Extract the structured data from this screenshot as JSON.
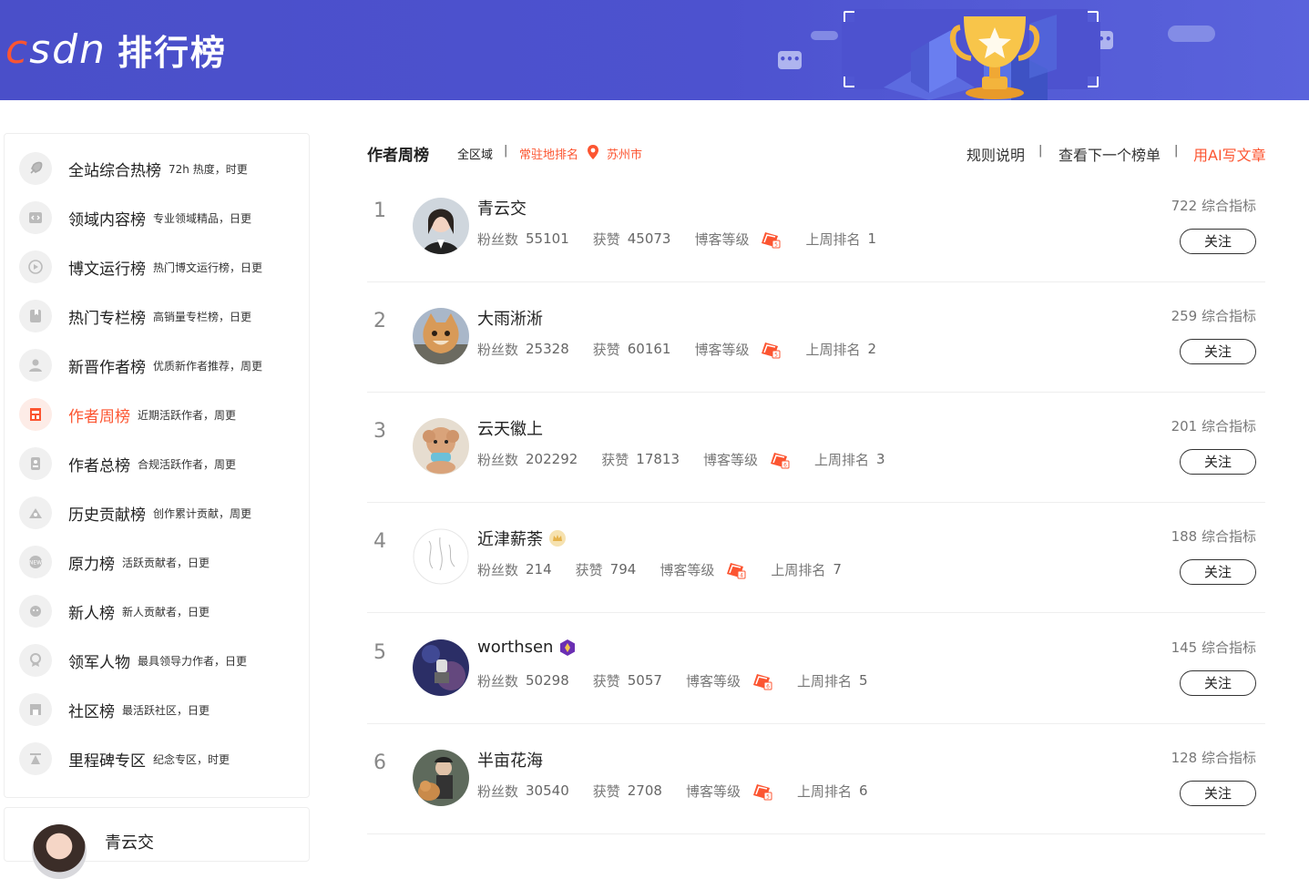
{
  "header": {
    "logo_text": "CSDN",
    "title": "排行榜"
  },
  "sidebar": {
    "items": [
      {
        "name": "全站综合热榜",
        "desc": "72h 热度，时更",
        "icon": "rocket-icon"
      },
      {
        "name": "领域内容榜",
        "desc": "专业领域精品，日更",
        "icon": "code-icon"
      },
      {
        "name": "博文运行榜",
        "desc": "热门博文运行榜，日更",
        "icon": "play-icon"
      },
      {
        "name": "热门专栏榜",
        "desc": "高销量专栏榜，日更",
        "icon": "book-icon"
      },
      {
        "name": "新晋作者榜",
        "desc": "优质新作者推荐，周更",
        "icon": "user-icon"
      },
      {
        "name": "作者周榜",
        "desc": "近期活跃作者，周更",
        "icon": "calendar-icon",
        "active": true
      },
      {
        "name": "作者总榜",
        "desc": "合规活跃作者，周更",
        "icon": "users-icon"
      },
      {
        "name": "历史贡献榜",
        "desc": "创作累计贡献，周更",
        "icon": "contribution-icon"
      },
      {
        "name": "原力榜",
        "desc": "活跃贡献者，日更",
        "icon": "force-icon"
      },
      {
        "name": "新人榜",
        "desc": "新人贡献者，日更",
        "icon": "newbie-icon"
      },
      {
        "name": "领军人物",
        "desc": "最具领导力作者，日更",
        "icon": "medal-icon"
      },
      {
        "name": "社区榜",
        "desc": "最活跃社区，日更",
        "icon": "community-icon"
      },
      {
        "name": "里程碑专区",
        "desc": "纪念专区，时更",
        "icon": "milestone-icon"
      }
    ]
  },
  "profile": {
    "name": "青云交"
  },
  "main": {
    "title": "作者周榜",
    "filter_all": "全区域",
    "filter_resident": "常驻地排名",
    "filter_city": "苏州市",
    "links": {
      "rules": "规则说明",
      "next": "查看下一个榜单",
      "ai": "用AI写文章"
    }
  },
  "labels": {
    "fans": "粉丝数",
    "likes": "获赞",
    "level": "博客等级",
    "last_rank": "上周排名",
    "score_suffix": "综合指标",
    "follow": "关注"
  },
  "rows": [
    {
      "rank": "1",
      "name": "青云交",
      "fans": "55101",
      "likes": "45073",
      "last_rank": "1",
      "score": "722",
      "badge": "",
      "level": "5"
    },
    {
      "rank": "2",
      "name": "大雨淅淅",
      "fans": "25328",
      "likes": "60161",
      "last_rank": "2",
      "score": "259",
      "badge": "",
      "level": "5"
    },
    {
      "rank": "3",
      "name": "云天徽上",
      "fans": "202292",
      "likes": "17813",
      "last_rank": "3",
      "score": "201",
      "badge": "",
      "level": "6"
    },
    {
      "rank": "4",
      "name": "近津薪荼",
      "fans": "214",
      "likes": "794",
      "last_rank": "7",
      "score": "188",
      "badge": "crown-badge-icon",
      "level": "4"
    },
    {
      "rank": "5",
      "name": "worthsen",
      "fans": "50298",
      "likes": "5057",
      "last_rank": "5",
      "score": "145",
      "badge": "hexagon-badge-icon",
      "level": "6"
    },
    {
      "rank": "6",
      "name": "半亩花海",
      "fans": "30540",
      "likes": "2708",
      "last_rank": "6",
      "score": "128",
      "badge": "",
      "level": "5"
    }
  ],
  "colors": {
    "accent": "#fc5531",
    "header_bg": "#4d52cf"
  }
}
